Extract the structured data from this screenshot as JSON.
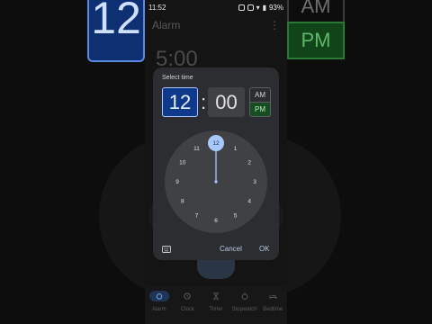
{
  "status_bar": {
    "time": "11:52",
    "battery": "93%"
  },
  "app_bar": {
    "title": "Alarm",
    "menu_glyph": "⋮"
  },
  "background": {
    "alarm_time": "5:00"
  },
  "dialog": {
    "title": "Select time",
    "hour": "12",
    "separator": ":",
    "minute": "00",
    "am_label": "AM",
    "pm_label": "PM",
    "selected_period": "PM",
    "clock_numbers": [
      "12",
      "1",
      "2",
      "3",
      "4",
      "5",
      "6",
      "7",
      "8",
      "9",
      "10",
      "11"
    ],
    "selected_hour": "12",
    "cancel_label": "Cancel",
    "ok_label": "OK"
  },
  "bottom_nav": {
    "items": [
      {
        "label": "Alarm",
        "icon": "alarm-icon",
        "active": true
      },
      {
        "label": "Clock",
        "icon": "clock-icon",
        "active": false
      },
      {
        "label": "Timer",
        "icon": "hourglass-icon",
        "active": false
      },
      {
        "label": "Stopwatch",
        "icon": "stopwatch-icon",
        "active": false
      },
      {
        "label": "Bedtime",
        "icon": "bed-icon",
        "active": false
      }
    ]
  },
  "colors": {
    "hour_selected_bg": "#0f3a8c",
    "pm_selected_bg": "#184d22",
    "dialog_bg": "#2b2d30",
    "clock_face": "#3f4145",
    "accent": "#a8c7fa"
  }
}
